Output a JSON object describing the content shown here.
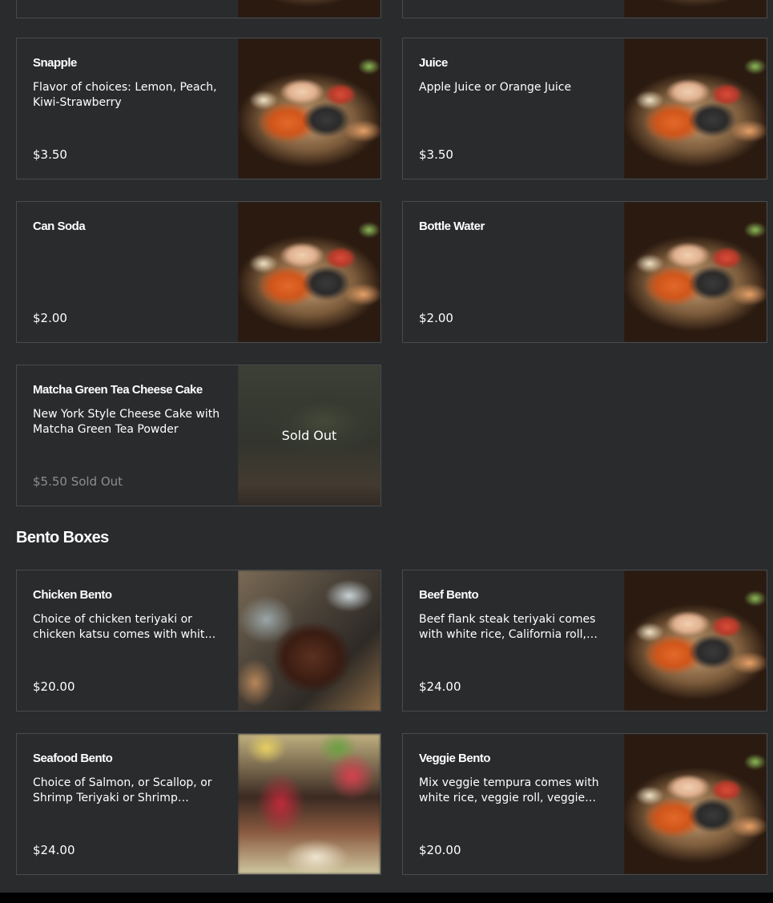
{
  "sections": {
    "bento_title": "Bento Boxes"
  },
  "drinks": [
    {
      "name": "Snapple",
      "desc": "Flavor of choices: Lemon, Peach, Kiwi-Strawberry",
      "price": "$3.50",
      "icon": "sushi-platter-photo"
    },
    {
      "name": "Juice",
      "desc": "Apple Juice or Orange Juice",
      "price": "$3.50",
      "icon": "sushi-platter-photo"
    },
    {
      "name": "Can Soda",
      "desc": "",
      "price": "$2.00",
      "icon": "sushi-platter-photo"
    },
    {
      "name": "Bottle Water",
      "desc": "",
      "price": "$2.00",
      "icon": "sushi-platter-photo"
    }
  ],
  "dessert": {
    "name": "Matcha Green Tea Cheese Cake",
    "desc": "New York Style Cheese Cake with Matcha Green Tea Powder",
    "price": "$5.50 Sold Out",
    "overlay": "Sold Out",
    "icon": "matcha-cheesecake-photo"
  },
  "bento": [
    {
      "name": "Chicken Bento",
      "desc": "Choice of chicken teriyaki or chicken katsu comes with white rice, California roll, gyoza, salad",
      "price": "$20.00",
      "icon": "chicken-bento-photo"
    },
    {
      "name": "Beef Bento",
      "desc": "Beef flank steak teriyaki comes with white rice, California roll, gyoza, salad",
      "price": "$24.00",
      "icon": "sushi-platter-photo"
    },
    {
      "name": "Seafood Bento",
      "desc": "Choice of Salmon, or Scallop, or Shrimp Teriyaki or Shrimp Tempura comes with white rice",
      "price": "$24.00",
      "icon": "seafood-bento-photo"
    },
    {
      "name": "Veggie Bento",
      "desc": "Mix veggie tempura comes with white rice, veggie roll, veggie gyoza, salad",
      "price": "$20.00",
      "icon": "sushi-platter-photo"
    }
  ],
  "colors": {
    "background": "#2a2b2d",
    "border": "#4a4b4d",
    "text": "#ffffff",
    "muted": "#8e8e8e"
  }
}
